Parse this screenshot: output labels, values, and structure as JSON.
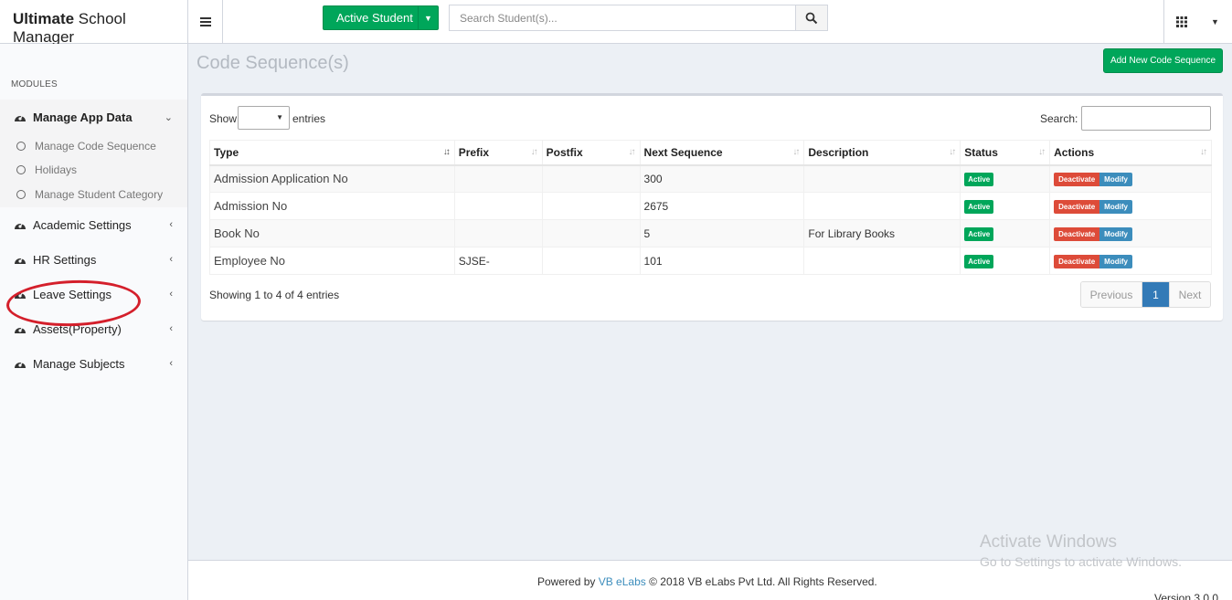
{
  "header": {
    "logo_bold": "Ultimate",
    "logo_rest": " School Manager",
    "active_student_label": "Active Student",
    "search_placeholder": "Search Student(s)..."
  },
  "sidebar": {
    "modules_label": "MODULES",
    "groups": [
      {
        "label": "Manage App Data",
        "children": [
          "Manage Code Sequence",
          "Holidays",
          "Manage Student Category"
        ]
      },
      {
        "label": "Academic Settings"
      },
      {
        "label": "HR Settings"
      },
      {
        "label": "Leave Settings"
      },
      {
        "label": "Assets(Property)"
      },
      {
        "label": "Manage Subjects"
      }
    ]
  },
  "page": {
    "title": "Code Sequence(s)",
    "add_button": "Add New Code Sequence",
    "show_label": "Show",
    "entries_label": "entries",
    "search_label": "Search:"
  },
  "table": {
    "headers": [
      "Type",
      "Prefix",
      "Postfix",
      "Next Sequence",
      "Description",
      "Status",
      "Actions"
    ],
    "rows": [
      {
        "type": "Admission Application No",
        "prefix": "",
        "postfix": "",
        "next": "300",
        "description": "",
        "status": "Active"
      },
      {
        "type": "Admission No",
        "prefix": "",
        "postfix": "",
        "next": "2675",
        "description": "",
        "status": "Active"
      },
      {
        "type": "Book No",
        "prefix": "",
        "postfix": "",
        "next": "5",
        "description": "For Library Books",
        "status": "Active"
      },
      {
        "type": "Employee No",
        "prefix": "SJSE-",
        "postfix": "",
        "next": "101",
        "description": "",
        "status": "Active"
      }
    ],
    "deactivate_label": "Deactivate",
    "modify_label": "Modify",
    "info": "Showing 1 to 4 of 4 entries",
    "pager": {
      "previous": "Previous",
      "page": "1",
      "next": "Next"
    }
  },
  "footer": {
    "powered_by": "Powered by",
    "link": "VB eLabs",
    "copyright": "© 2018 VB eLabs Pvt Ltd. All Rights Reserved.",
    "version": "Version 3.0.0"
  },
  "watermark": {
    "line1": "Activate Windows",
    "line2": "Go to Settings to activate Windows."
  }
}
